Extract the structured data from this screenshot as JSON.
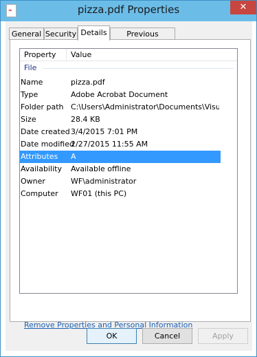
{
  "window": {
    "title": "pizza.pdf Properties",
    "close_glyph": "✕",
    "app_icon": "pdf-file-icon"
  },
  "tabs": [
    {
      "label": "General"
    },
    {
      "label": "Security"
    },
    {
      "label": "Details"
    },
    {
      "label": "Previous Versions"
    }
  ],
  "list": {
    "columns": [
      "Property",
      "Value"
    ],
    "group": "File",
    "rows": [
      {
        "key": "Name",
        "value": "pizza.pdf"
      },
      {
        "key": "Type",
        "value": "Adobe Acrobat Document"
      },
      {
        "key": "Folder path",
        "value": "C:\\Users\\Administrator\\Documents\\Visual ..."
      },
      {
        "key": "Size",
        "value": "28.4 KB"
      },
      {
        "key": "Date created",
        "value": "3/4/2015 7:01 PM"
      },
      {
        "key": "Date modified",
        "value": "2/27/2015 11:55 AM"
      },
      {
        "key": "Attributes",
        "value": "A"
      },
      {
        "key": "Availability",
        "value": "Available offline"
      },
      {
        "key": "Owner",
        "value": "WF\\administrator"
      },
      {
        "key": "Computer",
        "value": "WF01 (this PC)"
      }
    ],
    "selected_row": "Attributes"
  },
  "link": "Remove Properties and Personal Information",
  "buttons": {
    "ok": "OK",
    "cancel": "Cancel",
    "apply": "Apply"
  },
  "colors": {
    "titlebar": "#6bbde8",
    "selection": "#3399ff",
    "close": "#c7463f"
  }
}
